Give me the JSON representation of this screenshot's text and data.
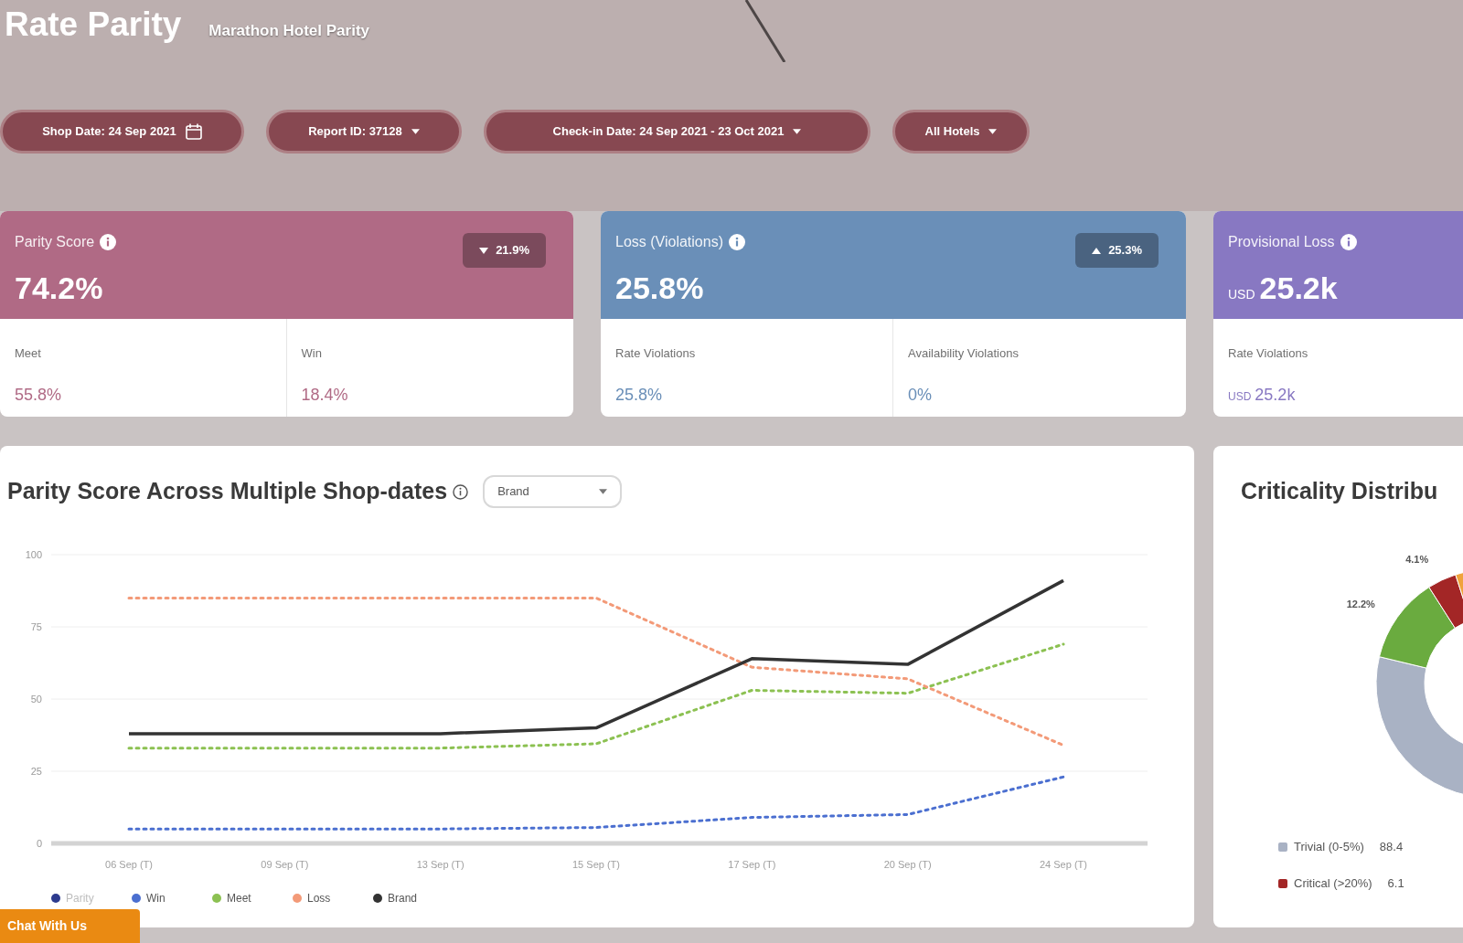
{
  "header": {
    "title": "Rate Parity",
    "subtitle": "Marathon Hotel Parity"
  },
  "filters": [
    {
      "kind": "date",
      "label": "Shop Date: 24 Sep 2021"
    },
    {
      "kind": "dropdown",
      "label": "Report ID: 37128"
    },
    {
      "kind": "dropdown",
      "label": "Check-in Date: 24 Sep 2021 - 23 Oct 2021"
    },
    {
      "kind": "dropdown",
      "label": "All Hotels"
    }
  ],
  "cards": [
    {
      "title": "Parity Score",
      "color": "#b06a85",
      "value": "74.2%",
      "badge": {
        "up": false,
        "text": "21.9%"
      },
      "metrics": [
        {
          "label": "Meet",
          "value": "55.8%"
        },
        {
          "label": "Win",
          "value": "18.4%"
        }
      ]
    },
    {
      "title": "Loss (Violations)",
      "color": "#6a8fb8",
      "value": "25.8%",
      "badge": {
        "up": true,
        "text": "25.3%"
      },
      "metrics": [
        {
          "label": "Rate Violations",
          "value": "25.8%"
        },
        {
          "label": "Availability Violations",
          "value": "0%"
        }
      ]
    },
    {
      "title": "Provisional Loss",
      "color": "#8878c2",
      "value_prefix": "USD",
      "value": "25.2k",
      "metrics": [
        {
          "label": "Rate Violations",
          "value_prefix": "USD",
          "value": "25.2k"
        }
      ]
    }
  ],
  "parity_chart": {
    "dropdown": {
      "value": "Brand"
    },
    "hidden_legend_items": [
      {
        "label": "Parity",
        "color": "#2d3b8e"
      }
    ],
    "chart_data": {
      "type": "line",
      "title": "Parity Score Across Multiple Shop-dates",
      "categories": [
        "06 Sep (T)",
        "09 Sep (T)",
        "13 Sep (T)",
        "15 Sep (T)",
        "17 Sep (T)",
        "20 Sep (T)",
        "24 Sep (T)"
      ],
      "ylim": [
        0,
        100
      ],
      "yticks": [
        0,
        25,
        50,
        75,
        100
      ],
      "grid": true,
      "series": [
        {
          "name": "Win",
          "color": "#4b6fd0",
          "line_style": "dotted",
          "values": [
            5,
            5,
            5,
            5.5,
            9,
            10,
            23
          ]
        },
        {
          "name": "Meet",
          "color": "#8cc152",
          "line_style": "dotted",
          "values": [
            33,
            33,
            33,
            34.5,
            53,
            52,
            69
          ]
        },
        {
          "name": "Loss",
          "color": "#f39a78",
          "line_style": "dotted",
          "values": [
            85,
            85,
            85,
            85,
            61,
            57,
            34
          ]
        },
        {
          "name": "Brand",
          "color": "#333333",
          "line_style": "solid",
          "values": [
            38,
            38,
            38,
            40,
            64,
            62,
            91
          ]
        }
      ]
    }
  },
  "criticality_chart": {
    "chart_data": {
      "type": "donut",
      "title": "Criticality Distribu",
      "values": [
        82.1,
        12.2,
        4.1,
        1.6
      ]
    },
    "slices": [
      {
        "color": "#a9b2c4"
      },
      {
        "color": "#6aab3f",
        "label": "12.2%"
      },
      {
        "color": "#a32626",
        "label": "4.1%"
      },
      {
        "color": "#f0a33c"
      }
    ],
    "legend": [
      {
        "label": "Trivial (0-5%)",
        "value": "88.4",
        "color": "#a9b2c4"
      },
      {
        "label": "Critical (>20%)",
        "value": "6.1",
        "color": "#a32626"
      }
    ]
  },
  "chat_button": {
    "label": "Chat With Us"
  }
}
